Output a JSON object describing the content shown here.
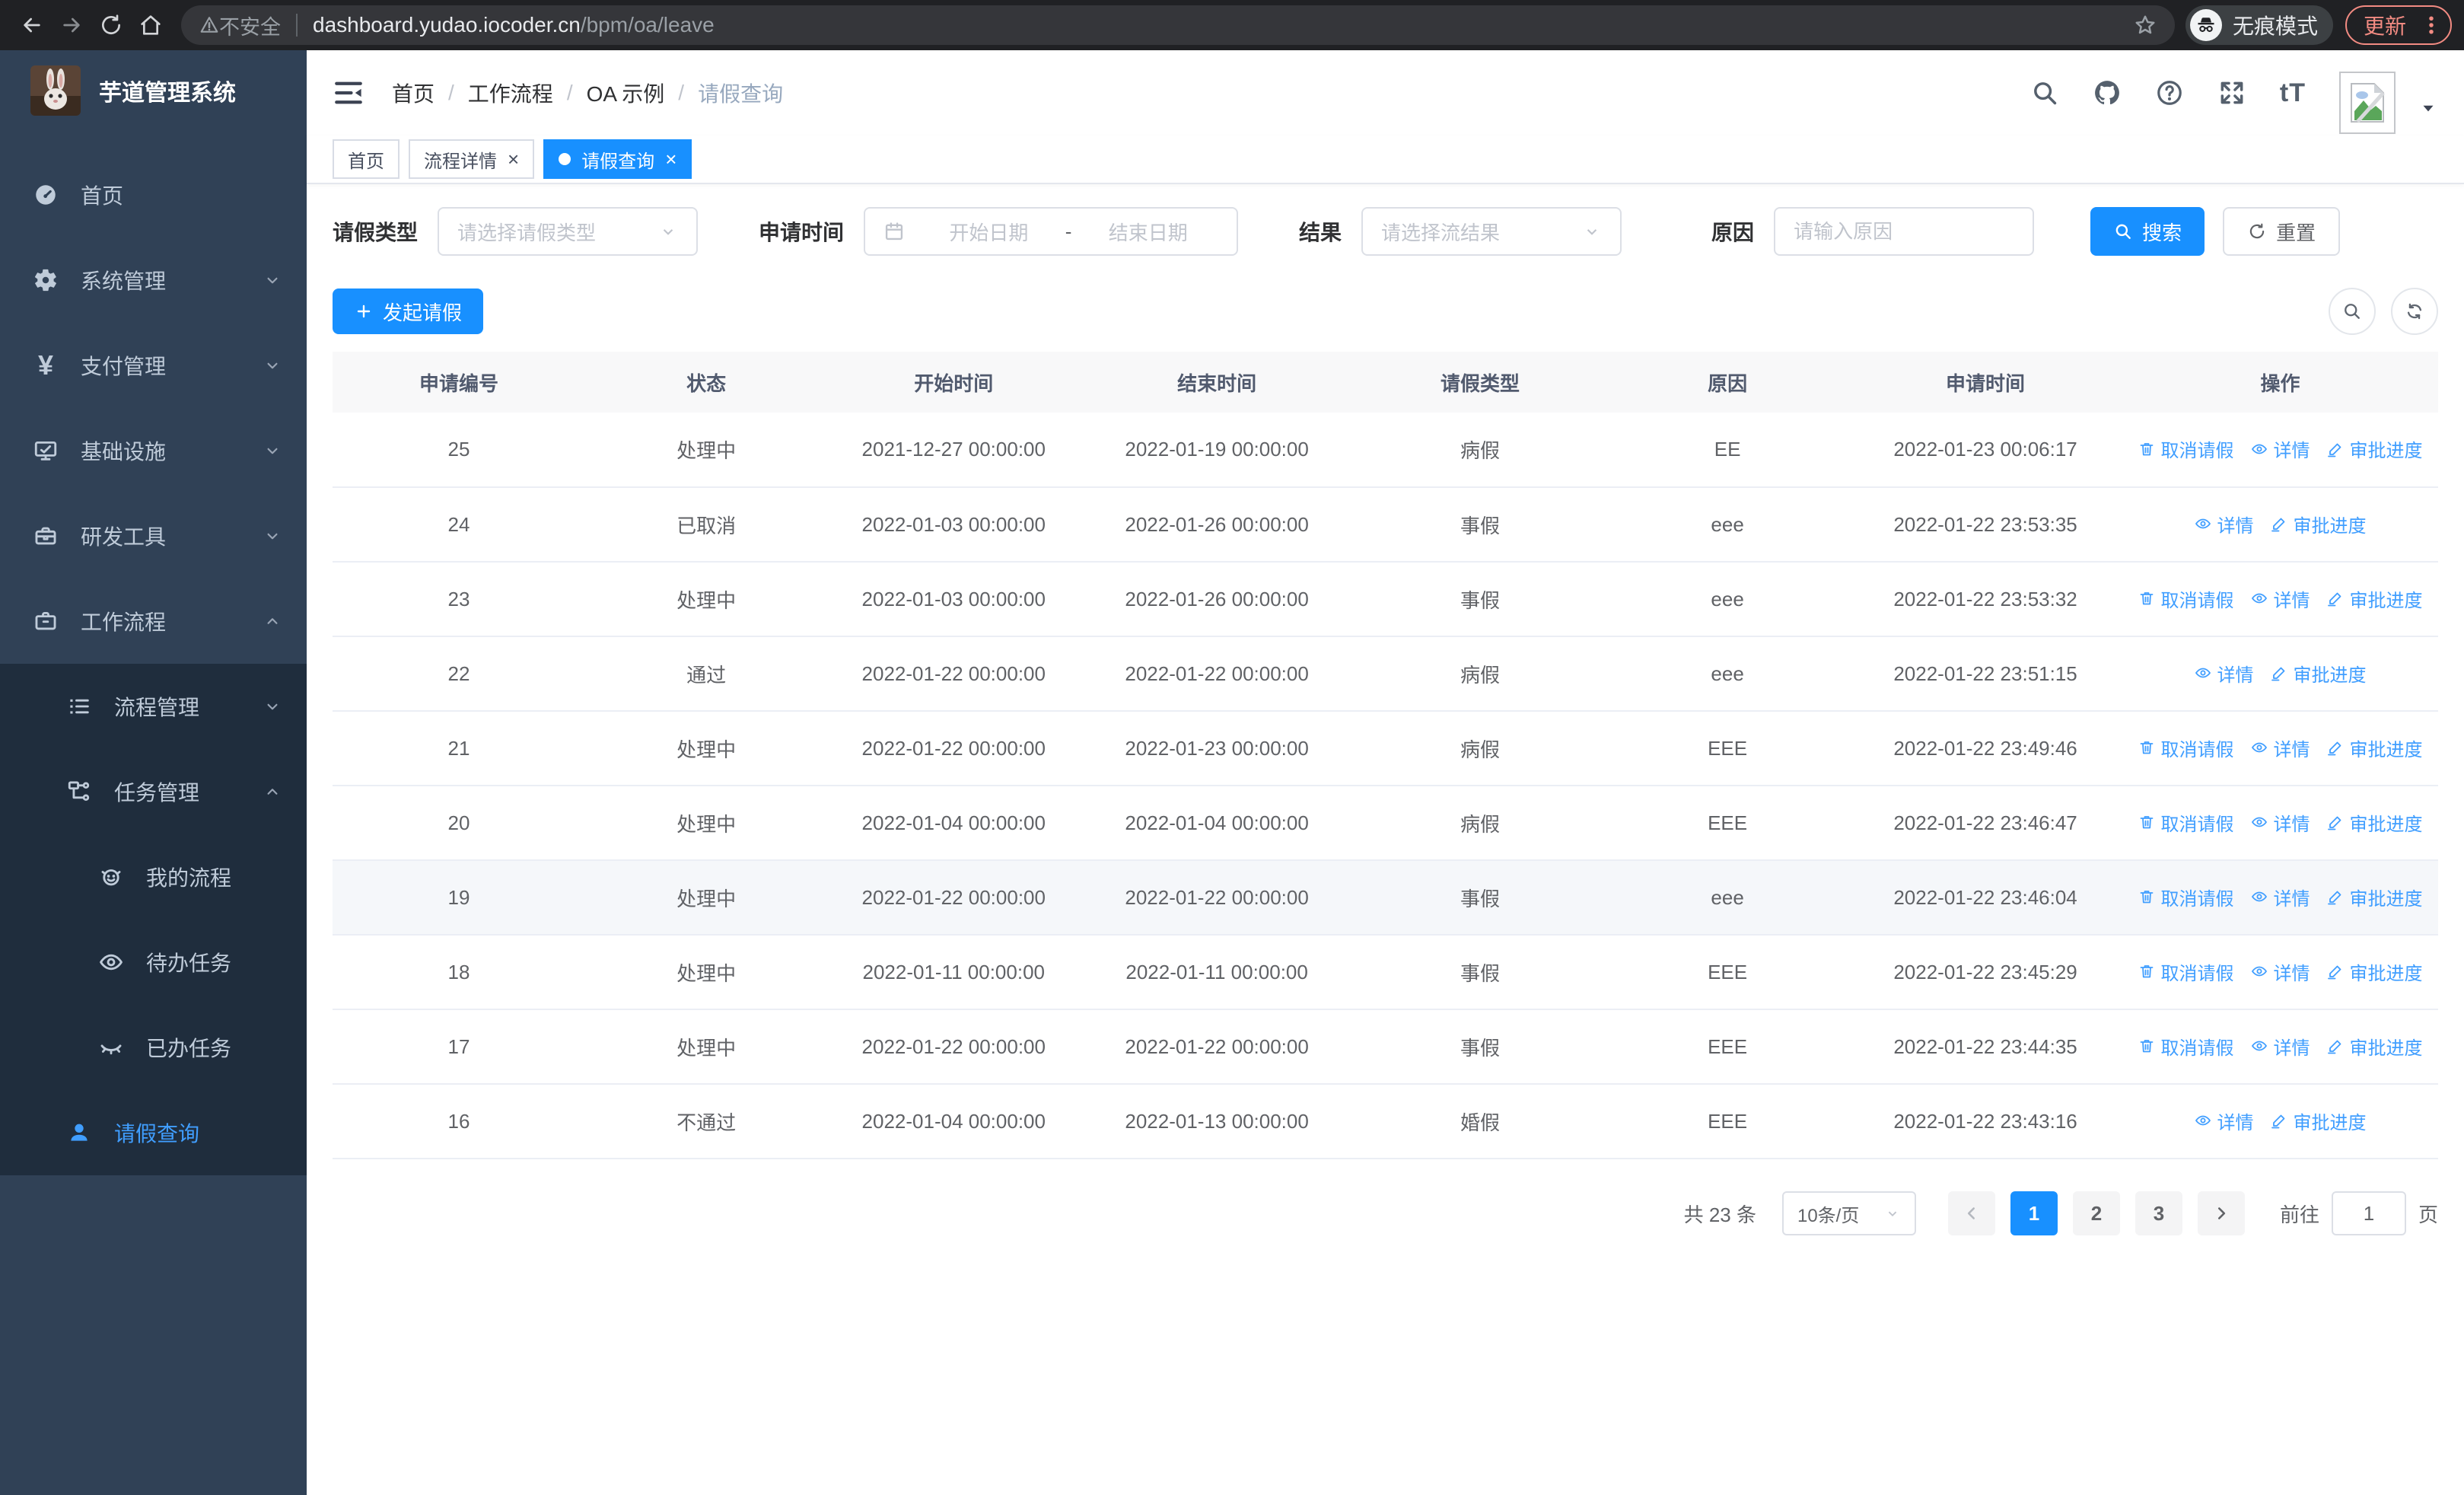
{
  "colors": {
    "primary": "#1890ff",
    "link": "#409eff",
    "sidebar_bg": "#304156",
    "submenu_bg": "#1f2d3d",
    "sidebar_text": "#bfcbd9",
    "active_blue": "#409eff",
    "update_red": "#f28b82"
  },
  "browser": {
    "security_warning": "不安全",
    "url_host": "dashboard.yudao.iocoder.cn",
    "url_path": "/bpm/oa/leave",
    "incognito_label": "无痕模式",
    "update_label": "更新"
  },
  "sidebar": {
    "title": "芋道管理系统",
    "items": [
      {
        "label": "首页",
        "icon": "dashboard-icon",
        "level": 1,
        "submenu": false,
        "chevron": "",
        "active": false
      },
      {
        "label": "系统管理",
        "icon": "gear-icon",
        "level": 1,
        "submenu": false,
        "chevron": "down",
        "active": false
      },
      {
        "label": "支付管理",
        "icon": "yen-icon",
        "level": 1,
        "submenu": false,
        "chevron": "down",
        "active": false
      },
      {
        "label": "基础设施",
        "icon": "monitor-icon",
        "level": 1,
        "submenu": false,
        "chevron": "down",
        "active": false
      },
      {
        "label": "研发工具",
        "icon": "toolbox-icon",
        "level": 1,
        "submenu": false,
        "chevron": "down",
        "active": false
      },
      {
        "label": "工作流程",
        "icon": "briefcase-icon",
        "level": 1,
        "submenu": false,
        "chevron": "up",
        "active": false
      },
      {
        "label": "流程管理",
        "icon": "list-icon",
        "level": 2,
        "submenu": true,
        "chevron": "down",
        "active": false
      },
      {
        "label": "任务管理",
        "icon": "tree-icon",
        "level": 2,
        "submenu": true,
        "chevron": "up",
        "active": false
      },
      {
        "label": "我的流程",
        "icon": "face-icon",
        "level": 3,
        "submenu": true,
        "chevron": "",
        "active": false
      },
      {
        "label": "待办任务",
        "icon": "eye-icon",
        "level": 3,
        "submenu": true,
        "chevron": "",
        "active": false
      },
      {
        "label": "已办任务",
        "icon": "eye-closed-icon",
        "level": 3,
        "submenu": true,
        "chevron": "",
        "active": false
      },
      {
        "label": "请假查询",
        "icon": "user-icon",
        "level": 2,
        "submenu": true,
        "chevron": "",
        "active": true
      }
    ]
  },
  "navbar": {
    "breadcrumb": [
      "首页",
      "工作流程",
      "OA 示例",
      "请假查询"
    ],
    "font_icon_label": "tT"
  },
  "tabs": [
    {
      "label": "首页",
      "closable": false,
      "active": false
    },
    {
      "label": "流程详情",
      "closable": true,
      "active": false
    },
    {
      "label": "请假查询",
      "closable": true,
      "active": true
    }
  ],
  "filters": {
    "leave_type_label": "请假类型",
    "leave_type_placeholder": "请选择请假类型",
    "apply_time_label": "申请时间",
    "date_start_placeholder": "开始日期",
    "date_separator": "-",
    "date_end_placeholder": "结束日期",
    "result_label": "结果",
    "result_placeholder": "请选择流结果",
    "reason_label": "原因",
    "reason_placeholder": "请输入原因",
    "search_label": "搜索",
    "reset_label": "重置"
  },
  "toolbar": {
    "create_label": "发起请假"
  },
  "table": {
    "columns": [
      "申请编号",
      "状态",
      "开始时间",
      "结束时间",
      "请假类型",
      "原因",
      "申请时间",
      "操作"
    ],
    "action_labels": {
      "cancel": "取消请假",
      "detail": "详情",
      "progress": "审批进度"
    },
    "rows": [
      {
        "id": "25",
        "status": "处理中",
        "start": "2021-12-27 00:00:00",
        "end": "2022-01-19 00:00:00",
        "type": "病假",
        "reason": "EE",
        "apply_time": "2022-01-23 00:06:17",
        "can_cancel": true,
        "hover": false
      },
      {
        "id": "24",
        "status": "已取消",
        "start": "2022-01-03 00:00:00",
        "end": "2022-01-26 00:00:00",
        "type": "事假",
        "reason": "eee",
        "apply_time": "2022-01-22 23:53:35",
        "can_cancel": false,
        "hover": false
      },
      {
        "id": "23",
        "status": "处理中",
        "start": "2022-01-03 00:00:00",
        "end": "2022-01-26 00:00:00",
        "type": "事假",
        "reason": "eee",
        "apply_time": "2022-01-22 23:53:32",
        "can_cancel": true,
        "hover": false
      },
      {
        "id": "22",
        "status": "通过",
        "start": "2022-01-22 00:00:00",
        "end": "2022-01-22 00:00:00",
        "type": "病假",
        "reason": "eee",
        "apply_time": "2022-01-22 23:51:15",
        "can_cancel": false,
        "hover": false
      },
      {
        "id": "21",
        "status": "处理中",
        "start": "2022-01-22 00:00:00",
        "end": "2022-01-23 00:00:00",
        "type": "病假",
        "reason": "EEE",
        "apply_time": "2022-01-22 23:49:46",
        "can_cancel": true,
        "hover": false
      },
      {
        "id": "20",
        "status": "处理中",
        "start": "2022-01-04 00:00:00",
        "end": "2022-01-04 00:00:00",
        "type": "病假",
        "reason": "EEE",
        "apply_time": "2022-01-22 23:46:47",
        "can_cancel": true,
        "hover": false
      },
      {
        "id": "19",
        "status": "处理中",
        "start": "2022-01-22 00:00:00",
        "end": "2022-01-22 00:00:00",
        "type": "事假",
        "reason": "eee",
        "apply_time": "2022-01-22 23:46:04",
        "can_cancel": true,
        "hover": true
      },
      {
        "id": "18",
        "status": "处理中",
        "start": "2022-01-11 00:00:00",
        "end": "2022-01-11 00:00:00",
        "type": "事假",
        "reason": "EEE",
        "apply_time": "2022-01-22 23:45:29",
        "can_cancel": true,
        "hover": false
      },
      {
        "id": "17",
        "status": "处理中",
        "start": "2022-01-22 00:00:00",
        "end": "2022-01-22 00:00:00",
        "type": "事假",
        "reason": "EEE",
        "apply_time": "2022-01-22 23:44:35",
        "can_cancel": true,
        "hover": false
      },
      {
        "id": "16",
        "status": "不通过",
        "start": "2022-01-04 00:00:00",
        "end": "2022-01-13 00:00:00",
        "type": "婚假",
        "reason": "EEE",
        "apply_time": "2022-01-22 23:43:16",
        "can_cancel": false,
        "hover": false
      }
    ]
  },
  "pagination": {
    "total_label": "共 23 条",
    "page_size": "10条/页",
    "pages": [
      "1",
      "2",
      "3"
    ],
    "active_page": "1",
    "goto_label": "前往",
    "goto_value": "1",
    "page_label": "页"
  }
}
